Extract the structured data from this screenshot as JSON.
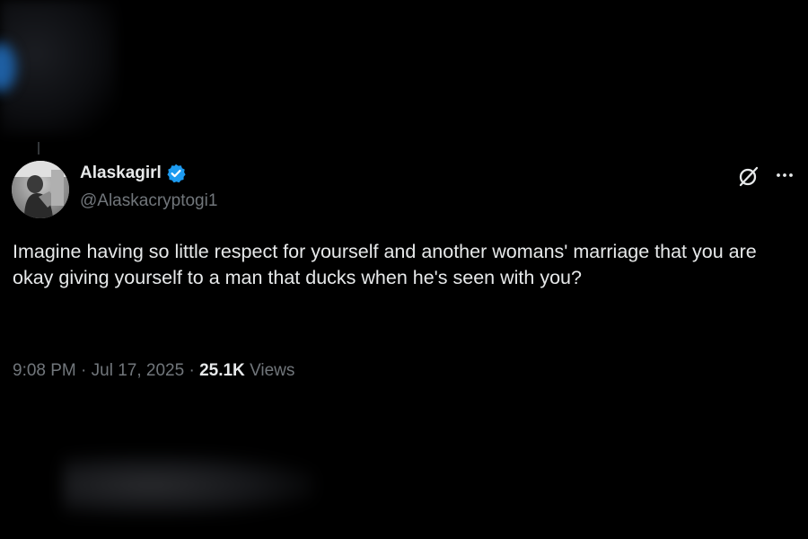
{
  "tweet": {
    "display_name": "Alaskagirl",
    "handle": "@Alaskacryptogi1",
    "verified": true,
    "text": "Imagine having so little respect for yourself and another womans' marriage that you are okay giving yourself to a man that ducks when he's seen with you?",
    "time": "9:08 PM",
    "date": "Jul 17, 2025",
    "separator": "·",
    "views_count": "25.1K",
    "views_label": "Views"
  },
  "icons": {
    "verified": "verified-badge-icon",
    "grok": "grok-icon",
    "more": "more-options-icon"
  },
  "colors": {
    "background": "#000000",
    "primary_text": "#e7e9ea",
    "secondary_text": "#71767b",
    "verified_blue": "#1d9bf0"
  }
}
